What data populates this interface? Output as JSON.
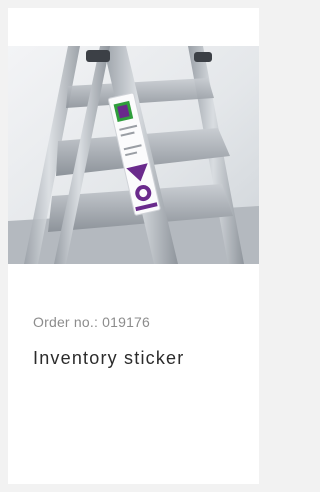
{
  "product": {
    "order_label": "Order no.: 019176",
    "title": "Inventory sticker",
    "image_subject": "ladder-with-inventory-sticker-photo"
  },
  "colors": {
    "card_background": "#ffffff",
    "page_background": "#f2f2f2",
    "sticker_purple": "#6a2a8c",
    "sticker_green": "#2f9e3c",
    "ladder_metal": "#b9bec4"
  }
}
